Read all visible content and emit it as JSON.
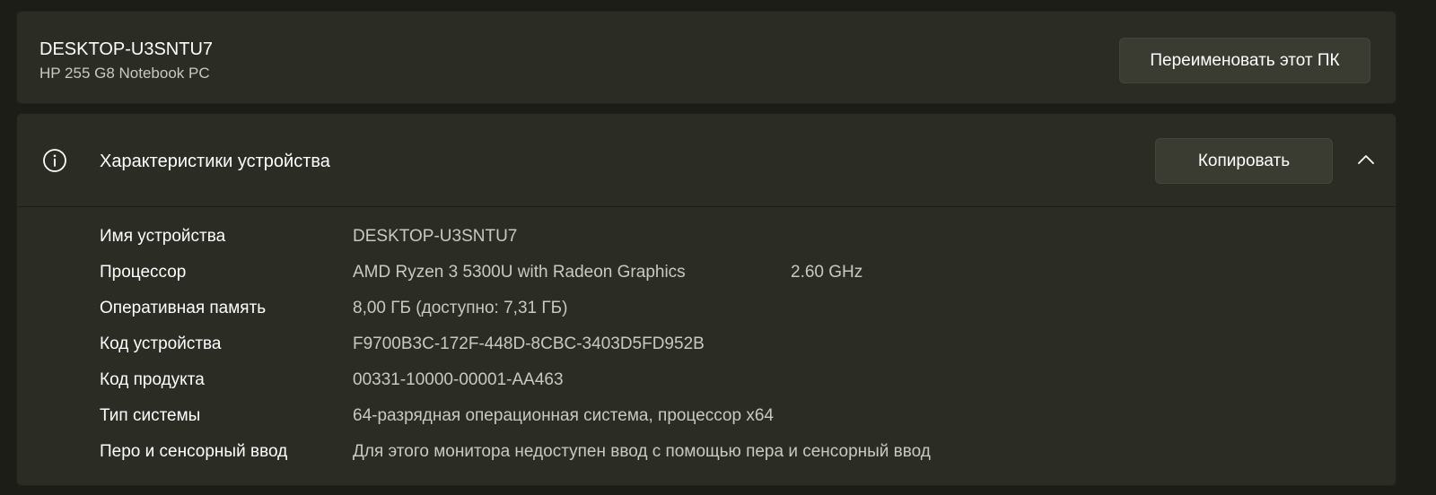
{
  "pc": {
    "name": "DESKTOP-U3SNTU7",
    "model": "HP 255 G8 Notebook PC",
    "rename_label": "Переименовать этот ПК"
  },
  "specs": {
    "icon": "info-icon",
    "title": "Характеристики устройства",
    "copy_label": "Копировать",
    "collapse_icon": "chevron-up-icon",
    "rows": [
      {
        "label": "Имя устройства",
        "value": "DESKTOP-U3SNTU7"
      },
      {
        "label": "Процессор",
        "value": "AMD Ryzen 3 5300U with Radeon Graphics",
        "extra": "2.60 GHz"
      },
      {
        "label": "Оперативная память",
        "value": "8,00 ГБ (доступно: 7,31 ГБ)"
      },
      {
        "label": "Код устройства",
        "value": "F9700B3C-172F-448D-8CBC-3403D5FD952B"
      },
      {
        "label": "Код продукта",
        "value": "00331-10000-00001-AA463"
      },
      {
        "label": "Тип системы",
        "value": "64-разрядная операционная система, процессор x64"
      },
      {
        "label": "Перо и сенсорный ввод",
        "value": "Для этого монитора недоступен ввод с помощью пера и сенсорный ввод"
      }
    ]
  }
}
